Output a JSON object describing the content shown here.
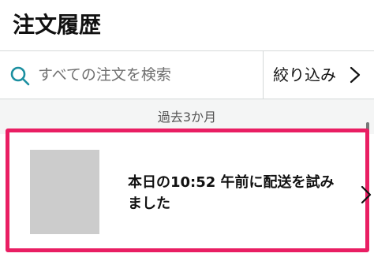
{
  "header": {
    "title": "注文履歴"
  },
  "search": {
    "placeholder": "すべての注文を検索",
    "value": "",
    "icon": "search-icon",
    "icon_color": "#1b8fa0"
  },
  "filter": {
    "label": "絞り込み",
    "icon": "chevron-right-icon"
  },
  "period": {
    "label": "過去3か月"
  },
  "orders": [
    {
      "status": "本日の10:52 午前に配送を試みました",
      "thumbnail": "product-thumbnail-placeholder",
      "highlight_color": "#e91e63"
    }
  ]
}
